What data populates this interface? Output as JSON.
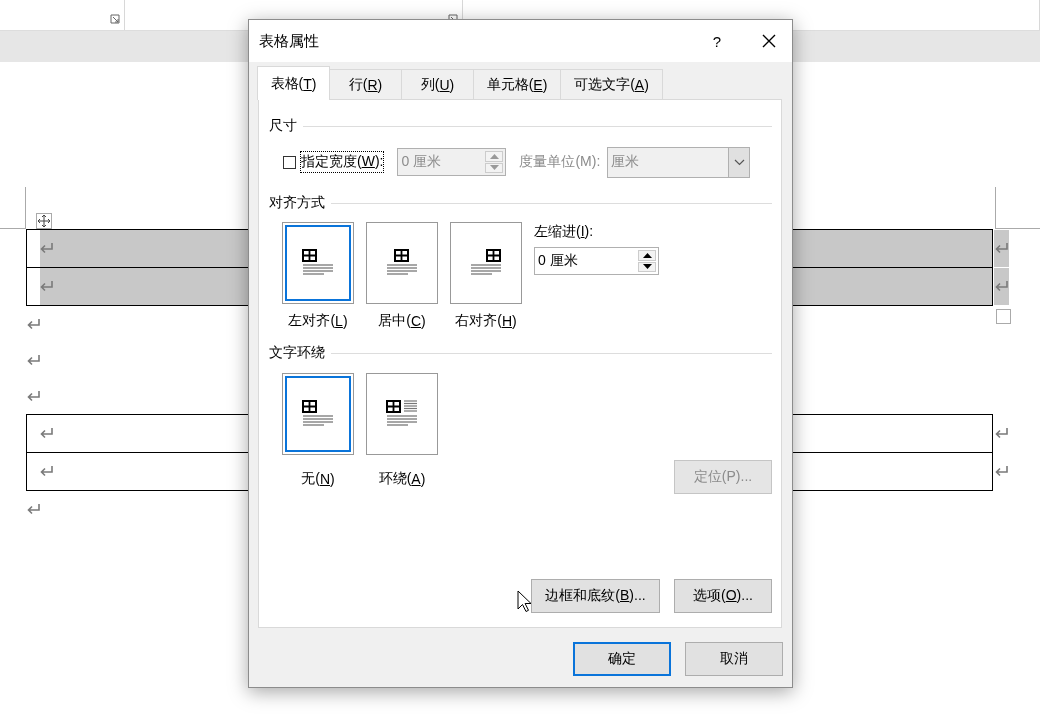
{
  "document": {
    "blocks": [
      {
        "kind": "table",
        "rows": [
          {
            "selected": true
          },
          {
            "selected": true
          }
        ]
      },
      {
        "kind": "paragraph"
      },
      {
        "kind": "paragraph"
      },
      {
        "kind": "paragraph"
      },
      {
        "kind": "table",
        "rows": [
          {
            "selected": false
          },
          {
            "selected": false
          }
        ]
      },
      {
        "kind": "paragraph"
      }
    ]
  },
  "dialog": {
    "title": "表格属性",
    "help": "?",
    "tabs": [
      {
        "label": "表格(T)",
        "selected": true
      },
      {
        "label": "行(R)",
        "selected": false
      },
      {
        "label": "列(U)",
        "selected": false
      },
      {
        "label": "单元格(E)",
        "selected": false
      },
      {
        "label": "可选文字(A)",
        "selected": false
      }
    ],
    "size": {
      "heading": "尺寸",
      "width_checkbox": {
        "label": "指定宽度(W):",
        "checked": false,
        "focused": true
      },
      "width_field": {
        "value": "0 厘米",
        "disabled": true
      },
      "unit_label": {
        "text": "度量单位(M):",
        "disabled": true
      },
      "unit_dropdown": {
        "value": "厘米",
        "disabled": true
      }
    },
    "alignment": {
      "heading": "对齐方式",
      "options": [
        {
          "kind": "left",
          "label": "左对齐(L)",
          "selected": true
        },
        {
          "kind": "center",
          "label": "居中(C)",
          "selected": false
        },
        {
          "kind": "right",
          "label": "右对齐(H)",
          "selected": false
        }
      ],
      "indent_label": "左缩进(I):",
      "indent_field": {
        "value": "0 厘米"
      }
    },
    "wrapping": {
      "heading": "文字环绕",
      "options": [
        {
          "kind": "none",
          "label": "无(N)",
          "selected": true
        },
        {
          "kind": "around",
          "label": "环绕(A)",
          "selected": false
        }
      ],
      "position_button": {
        "label": "定位(P)...",
        "disabled": true
      }
    },
    "panel_buttons": [
      {
        "label": "边框和底纹(B)..."
      },
      {
        "label": "选项(O)..."
      }
    ],
    "footer_buttons": [
      {
        "label": "确定",
        "default": true
      },
      {
        "label": "取消",
        "default": false
      }
    ]
  }
}
